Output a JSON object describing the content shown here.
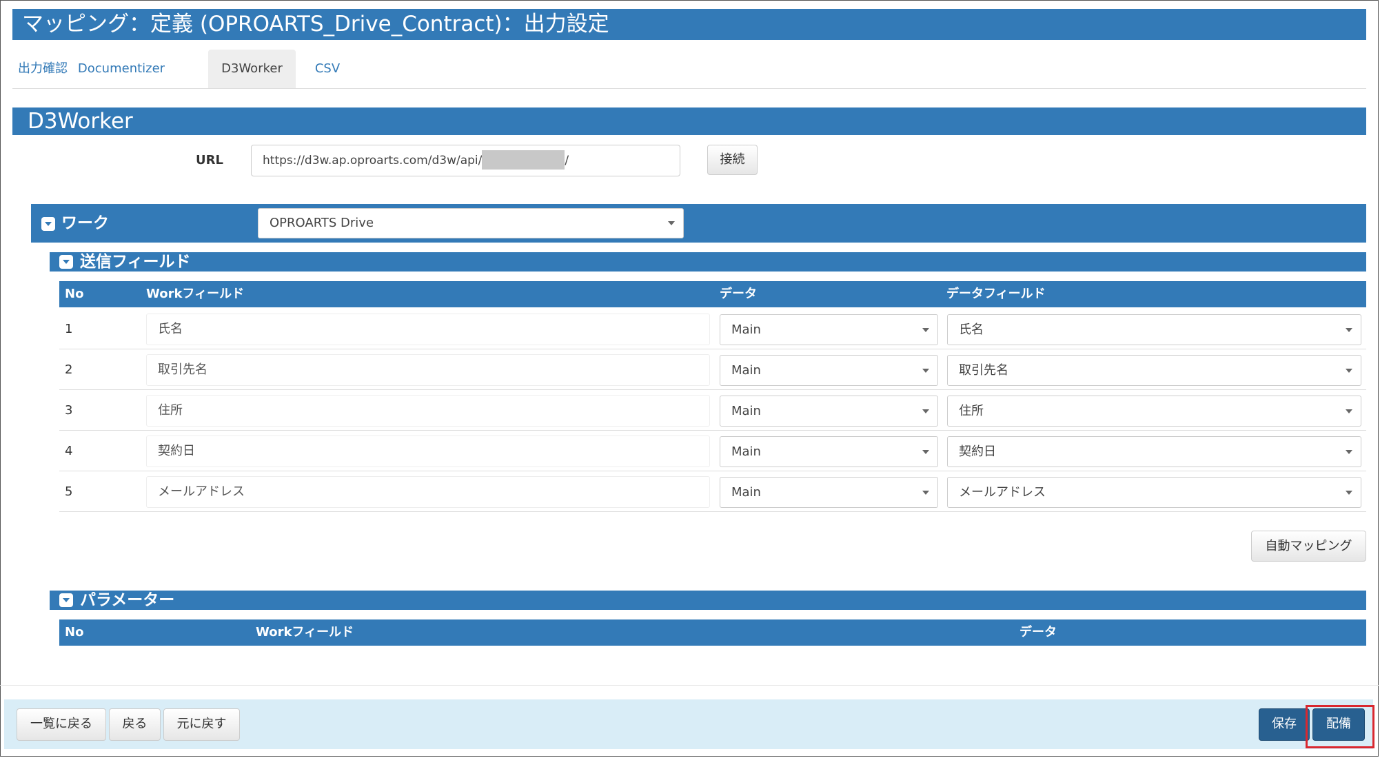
{
  "page": {
    "title": "マッピング：定義 (OPROARTS_Drive_Contract)：出力設定"
  },
  "tabs": [
    {
      "label": "出力確認",
      "active": false
    },
    {
      "label": "Documentizer",
      "active": false
    },
    {
      "label": "D3Worker",
      "active": true
    },
    {
      "label": "CSV",
      "active": false
    }
  ],
  "section": {
    "title": "D3Worker"
  },
  "url": {
    "label": "URL",
    "value_prefix": "https://d3w.ap.oproarts.com/d3w/api/",
    "value_suffix": "/",
    "connect_label": "接続"
  },
  "work": {
    "label": "ワーク",
    "selected": "OPROARTS Drive"
  },
  "send_fields": {
    "title": "送信フィールド",
    "columns": [
      "No",
      "Workフィールド",
      "データ",
      "データフィールド"
    ],
    "rows": [
      {
        "no": "1",
        "work_field": "氏名",
        "data": "Main",
        "data_field": "氏名"
      },
      {
        "no": "2",
        "work_field": "取引先名",
        "data": "Main",
        "data_field": "取引先名"
      },
      {
        "no": "3",
        "work_field": "住所",
        "data": "Main",
        "data_field": "住所"
      },
      {
        "no": "4",
        "work_field": "契約日",
        "data": "Main",
        "data_field": "契約日"
      },
      {
        "no": "5",
        "work_field": "メールアドレス",
        "data": "Main",
        "data_field": "メールアドレス"
      }
    ],
    "auto_mapping_label": "自動マッピング"
  },
  "parameters": {
    "title": "パラメーター",
    "columns": [
      "No",
      "Workフィールド",
      "データ"
    ]
  },
  "footer": {
    "back_to_list": "一覧に戻る",
    "back": "戻る",
    "revert": "元に戻す",
    "save": "保存",
    "deploy": "配備"
  },
  "colors": {
    "primary": "#337ab7",
    "footer_bg": "#d9edf7",
    "highlight": "#d9282f"
  }
}
